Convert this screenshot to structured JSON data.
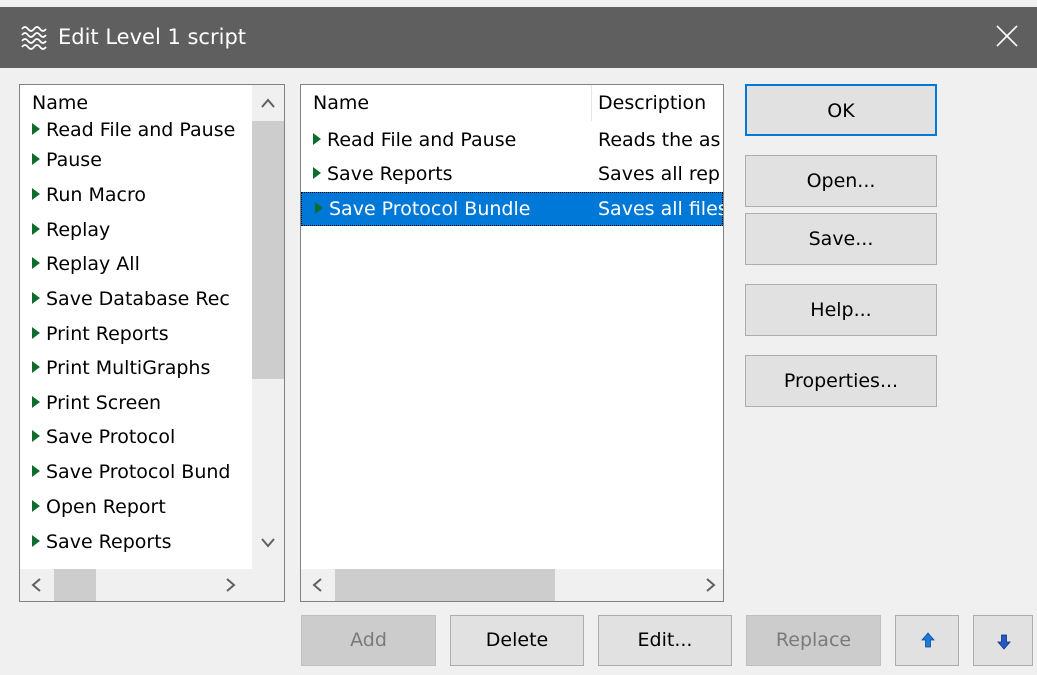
{
  "window": {
    "title": "Edit Level 1 script"
  },
  "left_list": {
    "header": "Name",
    "items": [
      "Read File and Pause",
      "Pause",
      "Run Macro",
      "Replay",
      "Replay All",
      "Save Database Rec",
      "Print Reports",
      "Print MultiGraphs",
      "Print Screen",
      "Save Protocol",
      "Save Protocol Bund",
      "Open Report",
      "Save Reports"
    ]
  },
  "right_list": {
    "headers": {
      "name": "Name",
      "description": "Description"
    },
    "rows": [
      {
        "name": "Read File and Pause",
        "description": "Reads the as"
      },
      {
        "name": "Save Reports",
        "description": "Saves all rep"
      },
      {
        "name": "Save Protocol Bundle",
        "description": "Saves all files",
        "selected": true
      }
    ]
  },
  "side_buttons": {
    "ok": "OK",
    "open": "Open...",
    "save": "Save...",
    "help": "Help...",
    "properties": "Properties..."
  },
  "bottom_buttons": {
    "add": "Add",
    "delete": "Delete",
    "edit": "Edit...",
    "replace": "Replace"
  },
  "icons": {
    "app": "waves-icon",
    "close": "close-icon",
    "move_up": "arrow-up-icon",
    "move_down": "arrow-down-icon"
  },
  "colors": {
    "titlebar": "#5f5f5f",
    "selection": "#0078d7",
    "default_border": "#0078d7",
    "tree_arrow": "#0f6b2e",
    "move_up_arrow": "#1e78d7",
    "move_down_arrow": "#2458c4"
  }
}
